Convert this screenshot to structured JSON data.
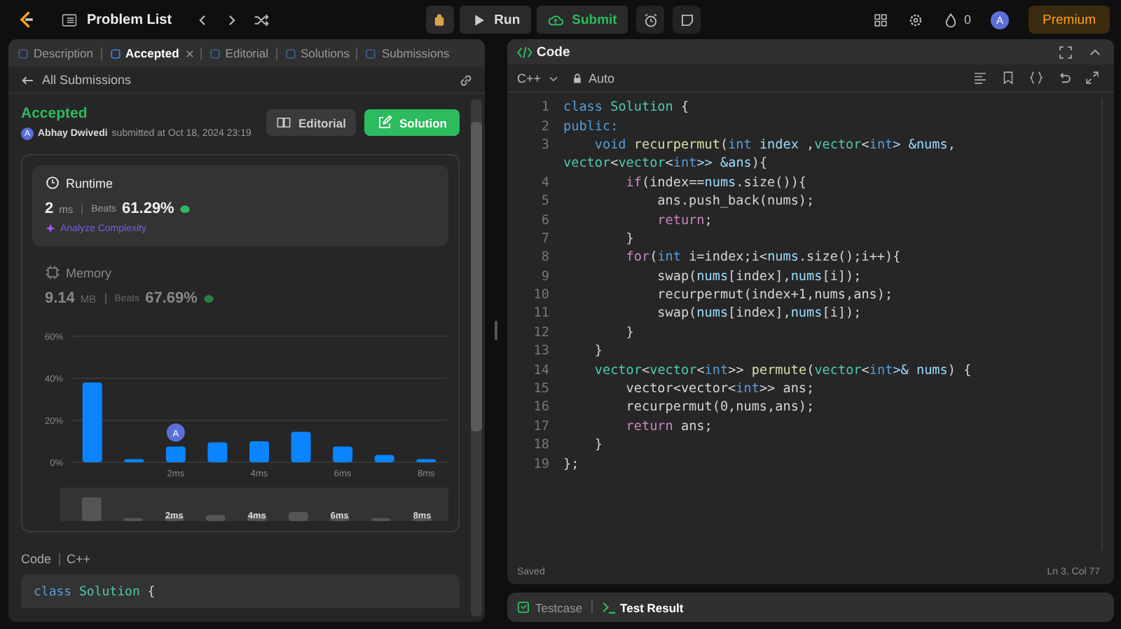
{
  "top_bar": {
    "title": "Problem List",
    "run_label": "Run",
    "submit_label": "Submit",
    "streak_count": "0",
    "avatar_letter": "A",
    "premium_label": "Premium"
  },
  "left_panel": {
    "tabs": [
      {
        "label": "Description",
        "selected": false,
        "closable": false
      },
      {
        "label": "Accepted",
        "selected": true,
        "closable": true
      },
      {
        "label": "Editorial",
        "selected": false,
        "closable": false
      },
      {
        "label": "Solutions",
        "selected": false,
        "closable": false
      },
      {
        "label": "Submissions",
        "selected": false,
        "closable": false
      }
    ],
    "back_link": "All Submissions",
    "status": "Accepted",
    "author_initial": "A",
    "author": "Abhay Dwivedi",
    "submitted_text": "submitted at Oct 18, 2024 23:19",
    "editorial_button": "Editorial",
    "solution_button": "Solution",
    "metrics": [
      {
        "kind": "runtime",
        "title": "Runtime",
        "value": "2",
        "unit": "ms",
        "beats_label": "Beats",
        "beats": "61.29%",
        "selected": true,
        "link": "Analyze Complexity"
      },
      {
        "kind": "memory",
        "title": "Memory",
        "value": "9.14",
        "unit": "MB",
        "beats_label": "Beats",
        "beats": "67.69%",
        "selected": false
      }
    ],
    "chart_data": {
      "type": "bar",
      "x": [
        0,
        1,
        2,
        3,
        4,
        5,
        6,
        7,
        8
      ],
      "xlim": [
        -0.5,
        8.5
      ],
      "values": [
        38,
        1.5,
        7.5,
        9.5,
        10,
        14.5,
        7.5,
        3.5,
        1.5
      ],
      "ylim": [
        0,
        60
      ],
      "yticks": [
        {
          "value": 0,
          "label": "0%"
        },
        {
          "value": 20,
          "label": "20%"
        },
        {
          "value": 40,
          "label": "40%"
        },
        {
          "value": 60,
          "label": "60%"
        }
      ],
      "xticks": [
        {
          "value": 2,
          "label": "2ms"
        },
        {
          "value": 4,
          "label": "4ms"
        },
        {
          "value": 6,
          "label": "6ms"
        },
        {
          "value": 8,
          "label": "8ms"
        }
      ],
      "annotations": [
        {
          "x": 2,
          "y": 7.5,
          "text": "A"
        }
      ]
    },
    "overview_labels": [
      "2ms",
      "4ms",
      "6ms",
      "8ms"
    ],
    "code_label": "Code",
    "code_language": "C++",
    "code_preview": [
      [
        {
          "text": "class",
          "kind": "kw"
        },
        {
          "text": " Solution",
          "kind": "type"
        },
        {
          "text": " {",
          "kind": "plain"
        }
      ]
    ]
  },
  "editor": {
    "title": "Code",
    "language": "C++",
    "mode": "Auto",
    "lines": [
      {
        "number": "1",
        "segments": [
          {
            "text": "class",
            "kind": "kw"
          },
          {
            "text": " Solution",
            "kind": "type"
          },
          {
            "text": " {",
            "kind": "plain"
          }
        ]
      },
      {
        "number": "2",
        "segments": [
          {
            "text": "public:",
            "kind": "kw"
          }
        ]
      },
      {
        "number": "3",
        "segments": [
          {
            "text": "    void",
            "kind": "kw"
          },
          {
            "text": " recurpermut",
            "kind": "fn"
          },
          {
            "text": "(",
            "kind": "plain"
          },
          {
            "text": "int",
            "kind": "kw"
          },
          {
            "text": " index",
            "kind": "var"
          },
          {
            "text": " ,",
            "kind": "plain"
          },
          {
            "text": "vector",
            "kind": "type"
          },
          {
            "text": "<",
            "kind": "plain"
          },
          {
            "text": "int",
            "kind": "kw"
          },
          {
            "text": "> &nums,",
            "kind": "var"
          }
        ]
      },
      {
        "segments": [
          {
            "text": "vector",
            "kind": "type"
          },
          {
            "text": "<",
            "kind": "plain"
          },
          {
            "text": "vector",
            "kind": "type"
          },
          {
            "text": "<",
            "kind": "plain"
          },
          {
            "text": "int",
            "kind": "kw"
          },
          {
            "text": ">> &ans",
            "kind": "var"
          },
          {
            "text": "){",
            "kind": "plain"
          }
        ]
      },
      {
        "number": "4",
        "segments": [
          {
            "text": "        if",
            "kind": "ctl"
          },
          {
            "text": "(index==",
            "kind": "plain"
          },
          {
            "text": "nums",
            "kind": "var"
          },
          {
            "text": ".size()){",
            "kind": "plain"
          }
        ]
      },
      {
        "number": "5",
        "segments": [
          {
            "text": "            ans.push_back(nums);",
            "kind": "plain"
          }
        ]
      },
      {
        "number": "6",
        "segments": [
          {
            "text": "            return",
            "kind": "ctl"
          },
          {
            "text": ";",
            "kind": "plain"
          }
        ]
      },
      {
        "number": "7",
        "segments": [
          {
            "text": "        }",
            "kind": "plain"
          }
        ]
      },
      {
        "number": "8",
        "segments": [
          {
            "text": "        for",
            "kind": "ctl"
          },
          {
            "text": "(",
            "kind": "plain"
          },
          {
            "text": "int",
            "kind": "kw"
          },
          {
            "text": " i=index;i<",
            "kind": "plain"
          },
          {
            "text": "nums",
            "kind": "var"
          },
          {
            "text": ".size();i++){",
            "kind": "plain"
          }
        ]
      },
      {
        "number": "9",
        "segments": [
          {
            "text": "            swap(",
            "kind": "plain"
          },
          {
            "text": "nums",
            "kind": "var"
          },
          {
            "text": "[index],",
            "kind": "plain"
          },
          {
            "text": "nums",
            "kind": "var"
          },
          {
            "text": "[i]);",
            "kind": "plain"
          }
        ]
      },
      {
        "number": "10",
        "segments": [
          {
            "text": "            recurpermut(index+1,nums,ans);",
            "kind": "plain"
          }
        ]
      },
      {
        "number": "11",
        "segments": [
          {
            "text": "            swap(",
            "kind": "plain"
          },
          {
            "text": "nums",
            "kind": "var"
          },
          {
            "text": "[index],",
            "kind": "plain"
          },
          {
            "text": "nums",
            "kind": "var"
          },
          {
            "text": "[i]);",
            "kind": "plain"
          }
        ]
      },
      {
        "number": "12",
        "segments": [
          {
            "text": "        }",
            "kind": "plain"
          }
        ]
      },
      {
        "number": "13",
        "segments": [
          {
            "text": "    }",
            "kind": "plain"
          }
        ]
      },
      {
        "number": "14",
        "segments": [
          {
            "text": "    vector",
            "kind": "type"
          },
          {
            "text": "<",
            "kind": "plain"
          },
          {
            "text": "vector",
            "kind": "type"
          },
          {
            "text": "<",
            "kind": "plain"
          },
          {
            "text": "int",
            "kind": "kw"
          },
          {
            "text": ">> ",
            "kind": "plain"
          },
          {
            "text": "permute",
            "kind": "fn"
          },
          {
            "text": "(",
            "kind": "plain"
          },
          {
            "text": "vector",
            "kind": "type"
          },
          {
            "text": "<",
            "kind": "plain"
          },
          {
            "text": "int",
            "kind": "kw"
          },
          {
            "text": ">& nums",
            "kind": "var"
          },
          {
            "text": ") {",
            "kind": "plain"
          }
        ]
      },
      {
        "number": "15",
        "segments": [
          {
            "text": "        vector<vector<",
            "kind": "plain"
          },
          {
            "text": "int",
            "kind": "kw"
          },
          {
            "text": ">> ans;",
            "kind": "plain"
          }
        ]
      },
      {
        "number": "16",
        "segments": [
          {
            "text": "        recurpermut(0,nums,ans);",
            "kind": "plain"
          }
        ]
      },
      {
        "number": "17",
        "segments": [
          {
            "text": "        return",
            "kind": "ctl"
          },
          {
            "text": " ans;",
            "kind": "plain"
          }
        ]
      },
      {
        "number": "18",
        "segments": [
          {
            "text": "    }",
            "kind": "plain"
          }
        ]
      },
      {
        "number": "19",
        "segments": [
          {
            "text": "};",
            "kind": "plain"
          }
        ]
      }
    ],
    "status": "Saved",
    "cursor": "Ln 3, Col 77"
  },
  "bottom_tabs": [
    {
      "label": "Testcase",
      "selected": false
    },
    {
      "label": "Test Result",
      "selected": true
    }
  ]
}
